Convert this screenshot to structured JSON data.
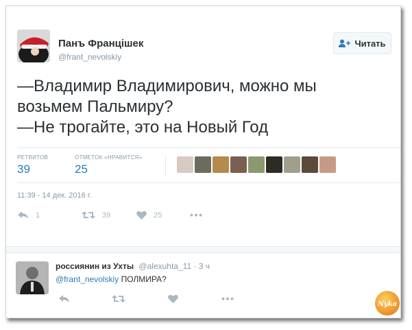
{
  "tweet": {
    "author_name": "Панъ Францішек",
    "author_handle": "@frant_nevolskiy",
    "follow_label": "Читать",
    "text_lines": [
      "—Владимир Владимирович, можно мы",
      "возьмем Пальмиру?",
      "—Не трогайте, это на Новый Год"
    ],
    "retweets_label": "РЕТВИТОВ",
    "retweets_count": "39",
    "likes_label": "ОТМЕТОК «НРАВИТСЯ»",
    "likes_count": "25",
    "timestamp": "11:39 - 14 дек. 2016 г.",
    "actions": {
      "reply_count": "1",
      "retweet_count": "39",
      "like_count": "25"
    }
  },
  "reply": {
    "author_name": "россиянин из Ухты",
    "author_handle": "@alexuhta_11",
    "time": "· 3 ч",
    "mention": "@frant_nevolskiy",
    "text": "ПОЛМИРА?"
  },
  "watermark_text": "Nyka",
  "likers": [
    {
      "icon": "liker-avatar-1",
      "color": "#d9c9c4"
    },
    {
      "icon": "liker-avatar-2",
      "color": "#6d6a5e"
    },
    {
      "icon": "liker-avatar-3",
      "color": "#b58a4d"
    },
    {
      "icon": "liker-avatar-4",
      "color": "#7b5f52"
    },
    {
      "icon": "liker-avatar-5",
      "color": "#8a9a6d"
    },
    {
      "icon": "liker-avatar-6",
      "color": "#2e2a26"
    },
    {
      "icon": "liker-avatar-7",
      "color": "#9f9f8c"
    },
    {
      "icon": "liker-avatar-8",
      "color": "#5c4a3b"
    },
    {
      "icon": "liker-avatar-9",
      "color": "#c79a88"
    }
  ],
  "colors": {
    "link": "#2b7bb9",
    "muted": "#8899a6",
    "icon": "#aab8c2",
    "text": "#292f33"
  }
}
